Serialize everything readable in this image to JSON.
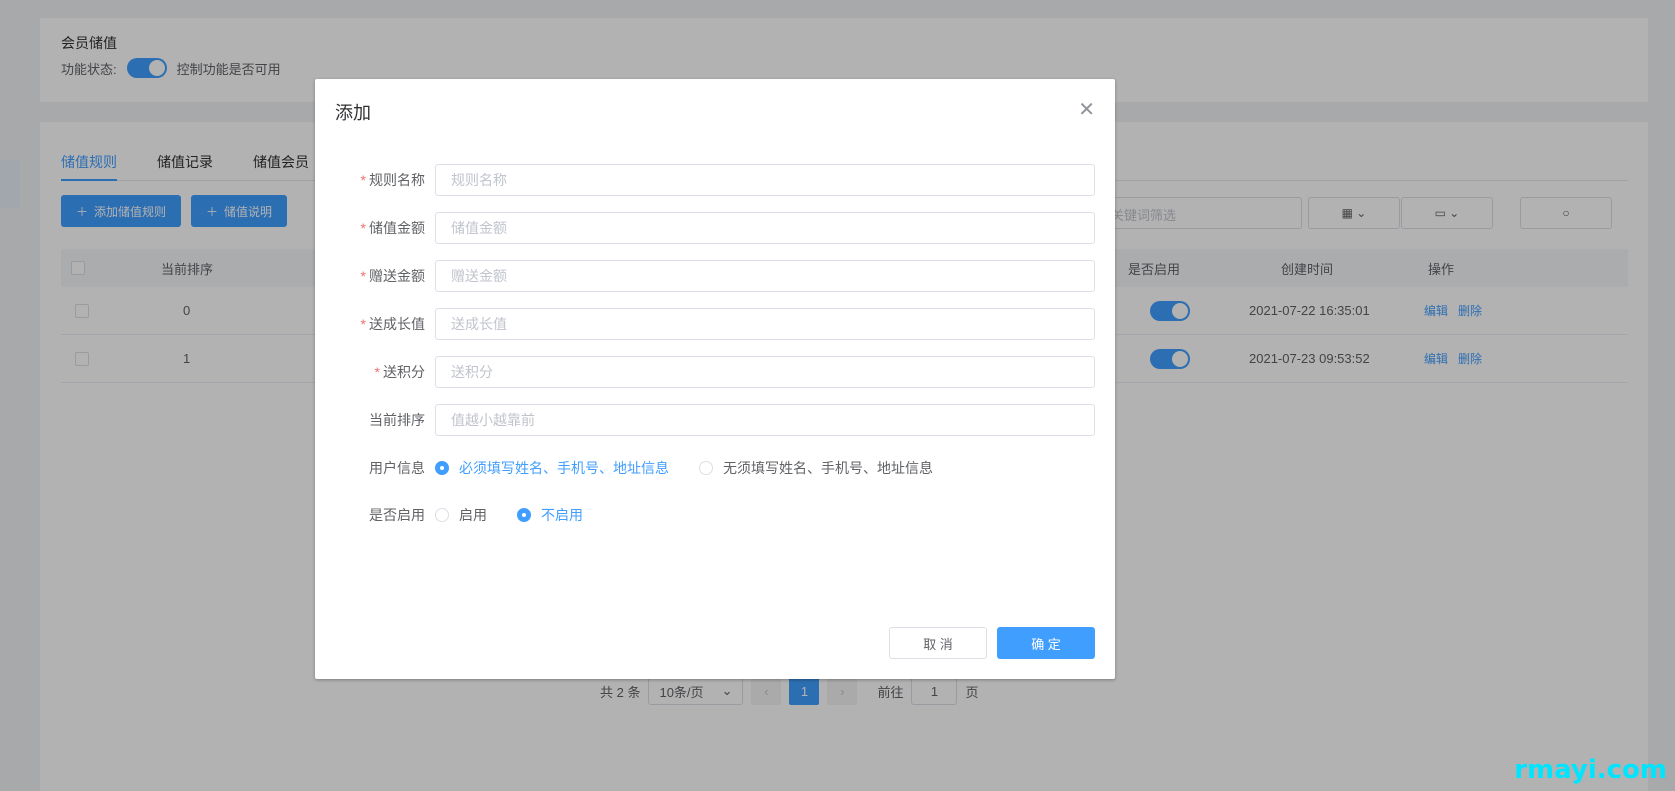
{
  "background": {
    "section_title": "会员储值",
    "status_label": "功能状态:",
    "status_hint": "控制功能是否可用",
    "tabs": [
      "储值规则",
      "储值记录",
      "储值会员"
    ],
    "buttons": {
      "add_rule": "添加储值规则",
      "rule_desc": "储值说明"
    },
    "search_placeholder": "关键词筛选",
    "table": {
      "headers": {
        "sort": "当前排序",
        "enabled": "是否启用",
        "created": "创建时间",
        "ops": "操作"
      },
      "rows": [
        {
          "sort": "0",
          "created": "2021-07-22 16:35:01",
          "edit": "编辑",
          "delete": "删除"
        },
        {
          "sort": "1",
          "created": "2021-07-23 09:53:52",
          "edit": "编辑",
          "delete": "删除"
        }
      ]
    },
    "pagination": {
      "total": "共 2 条",
      "page_size": "10条/页",
      "current_page": "1",
      "goto_label": "前往",
      "goto_value": "1",
      "page_unit": "页"
    }
  },
  "dialog": {
    "title": "添加",
    "fields": [
      {
        "label": "规则名称",
        "required": true,
        "placeholder": "规则名称"
      },
      {
        "label": "储值金额",
        "required": true,
        "placeholder": "储值金额"
      },
      {
        "label": "赠送金额",
        "required": true,
        "placeholder": "赠送金额"
      },
      {
        "label": "送成长值",
        "required": true,
        "placeholder": "送成长值"
      },
      {
        "label": "送积分",
        "required": true,
        "placeholder": "送积分"
      },
      {
        "label": "当前排序",
        "required": false,
        "placeholder": "值越小越靠前"
      }
    ],
    "user_info": {
      "label": "用户信息",
      "options": [
        "必须填写姓名、手机号、地址信息",
        "无须填写姓名、手机号、地址信息"
      ],
      "selected": 0
    },
    "enabled": {
      "label": "是否启用",
      "options": [
        "启用",
        "不启用"
      ],
      "selected": 1
    },
    "cancel_label": "取 消",
    "confirm_label": "确 定",
    "required_mark": "*"
  },
  "watermark": "rmayi.com",
  "colors": {
    "primary": "#409eff",
    "required": "#f56c6c",
    "overlay": "rgba(0,0,0,0.3)"
  },
  "icons": {
    "close": "close-icon",
    "plus": "plus-icon",
    "search": "search-icon"
  }
}
